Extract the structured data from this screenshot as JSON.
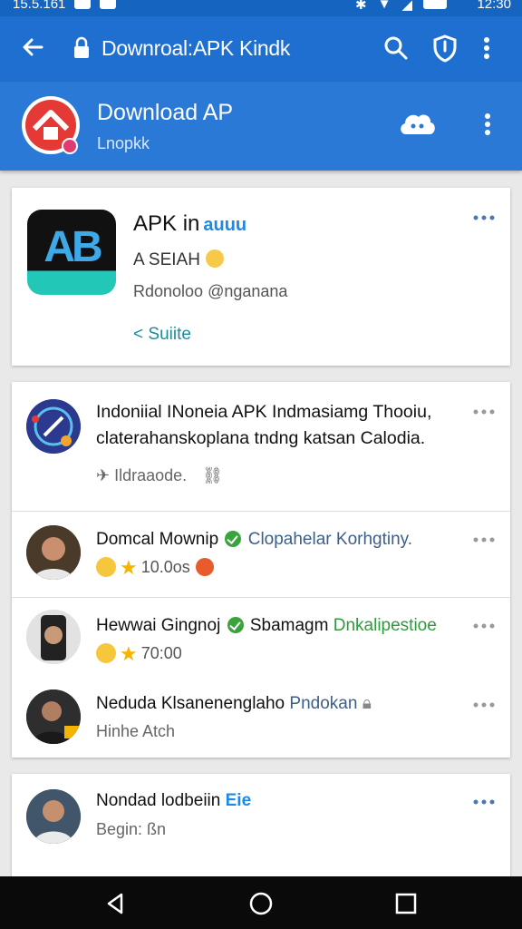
{
  "status_bar": {
    "time_left": "15.5.161",
    "time_right": "12:30"
  },
  "toolbar": {
    "url": "Downroal:APK Kindk",
    "icons": [
      "back-arrow-icon",
      "lock-icon",
      "search-icon",
      "shield-icon",
      "more-vert-icon"
    ]
  },
  "app_header": {
    "title": "Download AP",
    "subtitle": "Lnopkk",
    "icons": [
      "app-logo",
      "cloud-icon",
      "more-vert-icon"
    ]
  },
  "hero": {
    "icon_text": "AB",
    "name": "APK in",
    "name_tag": "auuu",
    "developer": "A SEIAH",
    "description": "Rdonoloo @nganana",
    "link": "Suiite"
  },
  "feed": {
    "post_text": "Indoniial INoneia APK Indmasiamg Thooiu, claterahanskoplana tndng katsan Calodia.",
    "post_meta": "Ildraaode.",
    "rows": [
      {
        "name": "Domcal Mownip",
        "extra": "Clopahelar Korhgtiny.",
        "sub": "10.0os"
      },
      {
        "name": "Hewwai Gingnoj",
        "extra": "Sbamagm",
        "extra_green": "Dnkalipestioe",
        "sub": "70:00"
      },
      {
        "name": "Neduda Klsanenenglaho",
        "extra": "Pndokan",
        "sub": "Hinhe Atch"
      }
    ]
  },
  "last_card": {
    "name": "Nondad lodbeiin",
    "tag": "Eie",
    "sub": "Begin: ßn"
  },
  "colors": {
    "toolbar": "#1e6fd0",
    "header": "#2a79d6",
    "accent": "#1e88e5",
    "verified": "#3aa43c"
  }
}
